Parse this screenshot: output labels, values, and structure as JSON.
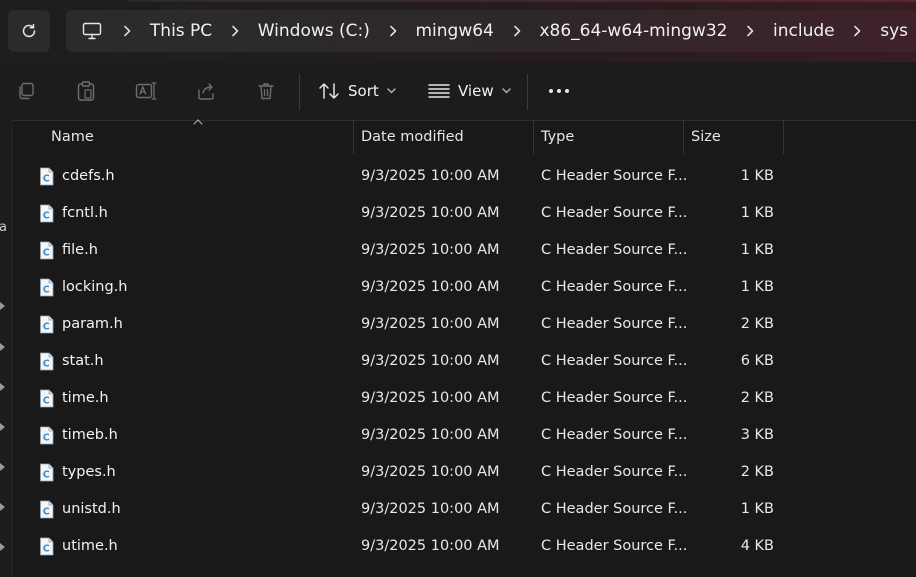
{
  "address_bar": {
    "crumbs": [
      "This PC",
      "Windows (C:)",
      "mingw64",
      "x86_64-w64-mingw32",
      "include",
      "sys"
    ],
    "icons": {
      "refresh": "refresh-icon",
      "location": "monitor-icon",
      "separator": "chevron-right-icon"
    }
  },
  "command_bar": {
    "sort_label": "Sort",
    "view_label": "View",
    "icons": [
      "copy-icon",
      "paste-icon",
      "rename-icon",
      "share-icon",
      "delete-icon",
      "sort-icon",
      "view-icon",
      "more-icon"
    ]
  },
  "nav_pane": {
    "partial_text": "a"
  },
  "file_list": {
    "columns": [
      "Name",
      "Date modified",
      "Type",
      "Size"
    ],
    "sorted_by": "Name",
    "rows": [
      {
        "name": "cdefs.h",
        "date": "9/3/2025 10:00 AM",
        "type": "C Header Source F...",
        "size": "1 KB"
      },
      {
        "name": "fcntl.h",
        "date": "9/3/2025 10:00 AM",
        "type": "C Header Source F...",
        "size": "1 KB"
      },
      {
        "name": "file.h",
        "date": "9/3/2025 10:00 AM",
        "type": "C Header Source F...",
        "size": "1 KB"
      },
      {
        "name": "locking.h",
        "date": "9/3/2025 10:00 AM",
        "type": "C Header Source F...",
        "size": "1 KB"
      },
      {
        "name": "param.h",
        "date": "9/3/2025 10:00 AM",
        "type": "C Header Source F...",
        "size": "2 KB"
      },
      {
        "name": "stat.h",
        "date": "9/3/2025 10:00 AM",
        "type": "C Header Source F...",
        "size": "6 KB"
      },
      {
        "name": "time.h",
        "date": "9/3/2025 10:00 AM",
        "type": "C Header Source F...",
        "size": "2 KB"
      },
      {
        "name": "timeb.h",
        "date": "9/3/2025 10:00 AM",
        "type": "C Header Source F...",
        "size": "3 KB"
      },
      {
        "name": "types.h",
        "date": "9/3/2025 10:00 AM",
        "type": "C Header Source F...",
        "size": "2 KB"
      },
      {
        "name": "unistd.h",
        "date": "9/3/2025 10:00 AM",
        "type": "C Header Source F...",
        "size": "1 KB"
      },
      {
        "name": "utime.h",
        "date": "9/3/2025 10:00 AM",
        "type": "C Header Source F...",
        "size": "4 KB"
      }
    ]
  },
  "colors": {
    "background": "#191919",
    "text": "#ffffff",
    "file_icon_accent": "#5bb8e8",
    "address_tint": "#3f2229"
  }
}
